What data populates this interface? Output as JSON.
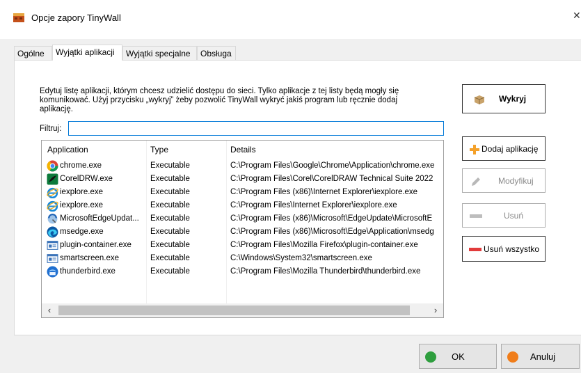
{
  "window": {
    "title": "Opcje zapory TinyWall"
  },
  "tabs": [
    {
      "label": "Ogólne"
    },
    {
      "label": "Wyjątki aplikacji"
    },
    {
      "label": "Wyjątki specjalne"
    },
    {
      "label": "Obsługa"
    }
  ],
  "description": "Edytuj listę aplikacji, którym chcesz udzielić dostępu do sieci. Tylko aplikacje z tej listy będą mogły się komunikować. Użyj przycisku „wykryj” żeby pozwolić TinyWall wykryć jakiś program lub ręcznie dodaj aplikację.",
  "filter": {
    "label": "Filtruj:",
    "value": ""
  },
  "list": {
    "columns": {
      "app": "Application",
      "type": "Type",
      "details": "Details"
    },
    "rows": [
      {
        "app": "chrome.exe",
        "type": "Executable",
        "details": "C:\\Program Files\\Google\\Chrome\\Application\\chrome.exe",
        "icon": "chrome-icon"
      },
      {
        "app": "CorelDRW.exe",
        "type": "Executable",
        "details": "C:\\Program Files\\Corel\\CorelDRAW Technical Suite 2022",
        "icon": "coreldraw-icon"
      },
      {
        "app": "iexplore.exe",
        "type": "Executable",
        "details": "C:\\Program Files (x86)\\Internet Explorer\\iexplore.exe",
        "icon": "internet-explorer-icon"
      },
      {
        "app": "iexplore.exe",
        "type": "Executable",
        "details": "C:\\Program Files\\Internet Explorer\\iexplore.exe",
        "icon": "internet-explorer-icon"
      },
      {
        "app": "MicrosoftEdgeUpdat...",
        "type": "Executable",
        "details": "C:\\Program Files (x86)\\Microsoft\\EdgeUpdate\\MicrosoftE",
        "icon": "edge-update-icon"
      },
      {
        "app": "msedge.exe",
        "type": "Executable",
        "details": "C:\\Program Files (x86)\\Microsoft\\Edge\\Application\\msedg",
        "icon": "edge-icon"
      },
      {
        "app": "plugin-container.exe",
        "type": "Executable",
        "details": "C:\\Program Files\\Mozilla Firefox\\plugin-container.exe",
        "icon": "window-app-icon"
      },
      {
        "app": "smartscreen.exe",
        "type": "Executable",
        "details": "C:\\Windows\\System32\\smartscreen.exe",
        "icon": "window-app-icon"
      },
      {
        "app": "thunderbird.exe",
        "type": "Executable",
        "details": "C:\\Program Files\\Mozilla Thunderbird\\thunderbird.exe",
        "icon": "thunderbird-icon"
      }
    ]
  },
  "buttons": {
    "detect": "Wykryj",
    "add": "Dodaj aplikację",
    "modify": "Modyfikuj",
    "remove": "Usuń",
    "remove_all": "Usuń wszystko",
    "ok": "OK",
    "cancel": "Anuluj"
  },
  "colors": {
    "focus_border": "#0078d7",
    "ok_dot": "#2e9e3e",
    "cancel_dot": "#f07d1a",
    "remove_all_bar": "#e23b3b",
    "add_plus": "#f4a12a"
  }
}
